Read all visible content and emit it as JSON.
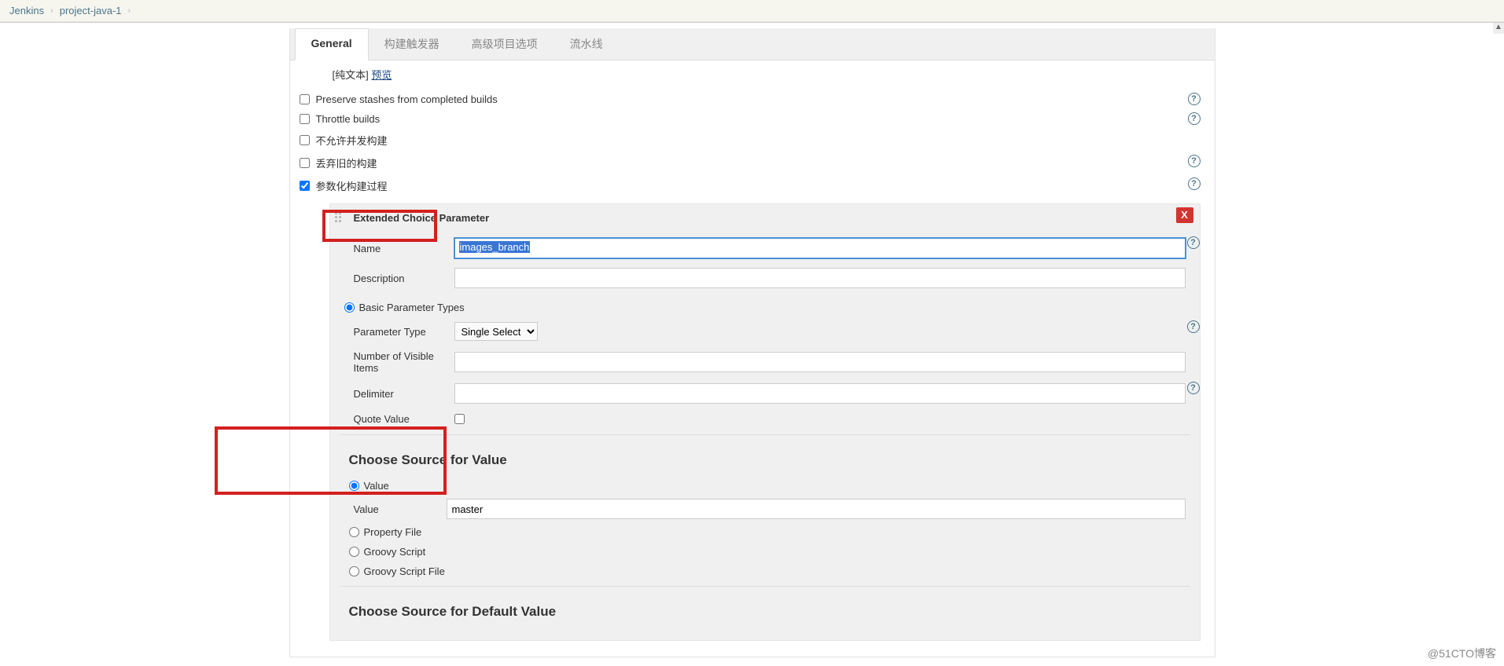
{
  "breadcrumb": {
    "root": "Jenkins",
    "project": "project-java-1"
  },
  "tabs": {
    "general": "General",
    "triggers": "构建触发器",
    "advanced": "高级项目选项",
    "pipeline": "流水线"
  },
  "plain_text": "[纯文本]",
  "preview_link": "预览",
  "checkboxes": {
    "preserve": "Preserve stashes from completed builds",
    "throttle": "Throttle builds",
    "noConcurrent": "不允许并发构建",
    "discardOld": "丢弃旧的构建",
    "parameterized": "参数化构建过程"
  },
  "param": {
    "block_title": "Extended Choice Parameter",
    "name_label": "Name",
    "name_value": "images_branch",
    "desc_label": "Description",
    "desc_value": "",
    "basic_types": "Basic Parameter Types",
    "param_type_label": "Parameter Type",
    "param_type_value": "Single Select",
    "visible_label": "Number of Visible Items",
    "visible_value": "",
    "delimiter_label": "Delimiter",
    "delimiter_value": "",
    "quote_label": "Quote Value"
  },
  "source_value": {
    "heading": "Choose Source for Value",
    "value_radio": "Value",
    "value_label": "Value",
    "value_input": "master",
    "property_file": "Property File",
    "groovy_script": "Groovy Script",
    "groovy_file": "Groovy Script File"
  },
  "source_default": {
    "heading": "Choose Source for Default Value"
  },
  "watermark": "@51CTO博客"
}
